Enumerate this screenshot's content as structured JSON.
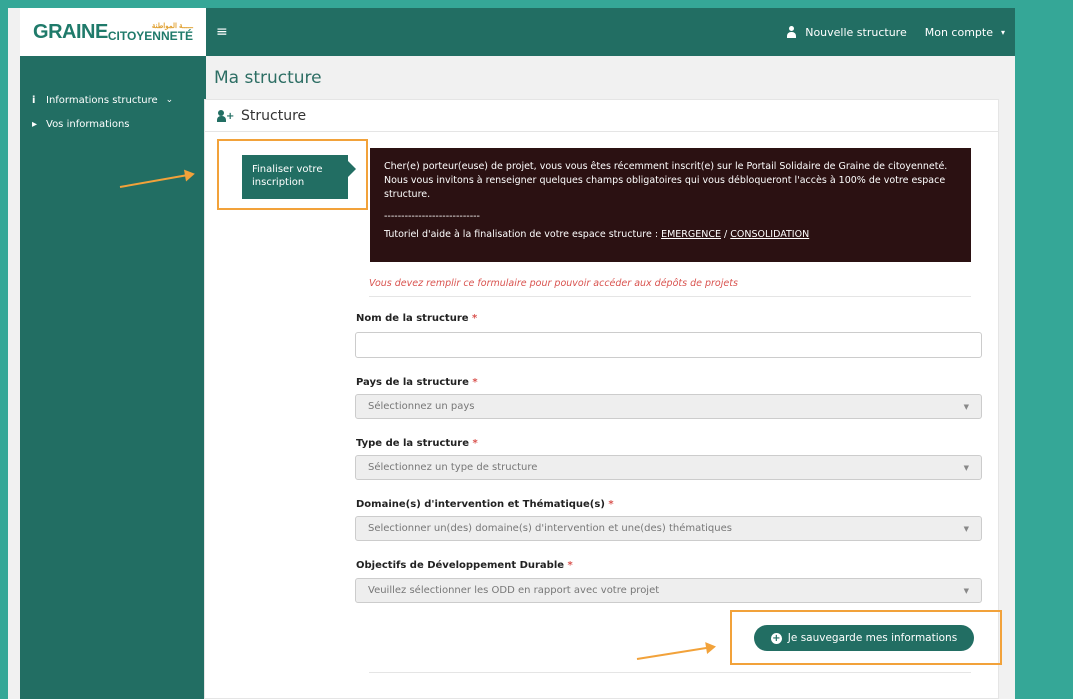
{
  "brand": {
    "logo_main": "GRAINE",
    "logo_sub": "CITOYENNETÉ",
    "logo_arabic": "ـــــة المواطنة"
  },
  "topbar": {
    "menu_icon": "hamburger-icon",
    "new_structure": "Nouvelle structure",
    "account": "Mon compte",
    "account_caret": "▾"
  },
  "sidebar": {
    "items": [
      {
        "icon": "i",
        "label": "Informations structure",
        "chevron": "⌄"
      },
      {
        "icon": "▸",
        "label": "Vos informations"
      }
    ]
  },
  "page": {
    "title": "Ma structure",
    "panel_title": "Structure"
  },
  "step": {
    "label": "Finaliser votre inscription"
  },
  "notice": {
    "text": "Cher(e) porteur(euse) de projet, vous vous êtes récemment inscrit(e) sur le Portail Solidaire de Graine de citoyenneté. Nous vous invitons à renseigner quelques champs obligatoires qui vous débloqueront l'accès à 100% de votre espace structure.",
    "separator": "----------------------------",
    "tutorial_prefix": "Tutoriel d'aide à la finalisation de votre espace structure : ",
    "link_emergence": "EMERGENCE",
    "slash": " / ",
    "link_consolidation": "CONSOLIDATION"
  },
  "form": {
    "warning": "Vous devez remplir ce formulaire pour pouvoir accéder aux dépôts de projets",
    "required_mark": "*",
    "nom": {
      "label": "Nom de la structure",
      "value": ""
    },
    "pays": {
      "label": "Pays de la structure",
      "placeholder": "Sélectionnez un pays"
    },
    "type": {
      "label": "Type de la structure",
      "placeholder": "Sélectionnez un type de structure"
    },
    "domaine": {
      "label": "Domaine(s) d'intervention et Thématique(s)",
      "placeholder": "Selectionner un(des) domaine(s) d'intervention et une(des) thématiques"
    },
    "odd": {
      "label": "Objectifs de Développement Durable",
      "placeholder": "Veuillez sélectionner les ODD en rapport avec votre projet"
    },
    "save_button": "Je sauvegarde mes informations"
  },
  "colors": {
    "primary": "#226e63",
    "highlight": "#f2a23a",
    "notice_bg": "#2b1112",
    "outer_bg": "#35a797"
  }
}
